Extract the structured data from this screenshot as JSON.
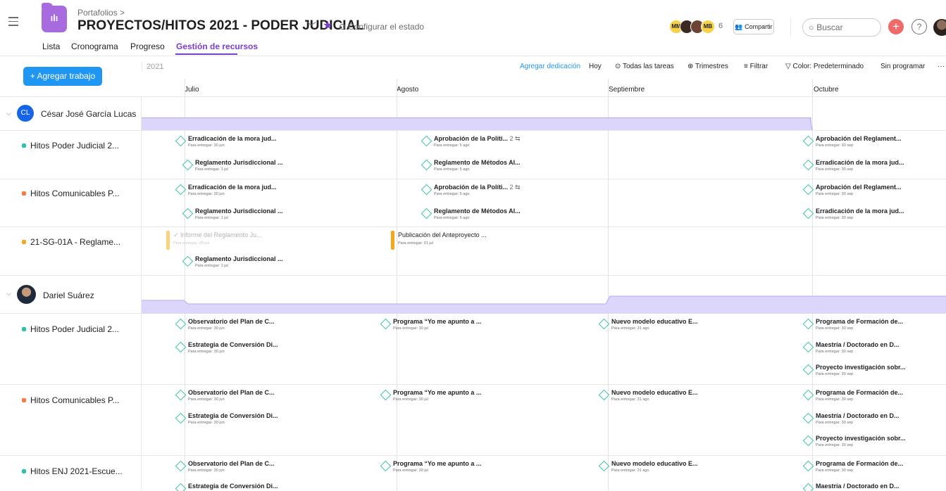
{
  "header": {
    "breadcrumb": "Portafolios >",
    "portfolio_icon": "chart-icon",
    "title": "PROYECTOS/HITOS 2021 - PODER JUDICIAL",
    "status": "Configurar el estado",
    "avatars": [
      "MM",
      "",
      "",
      "MB"
    ],
    "avatar_count": "6",
    "share": "Compartir",
    "search_placeholder": "Buscar",
    "help": "?"
  },
  "tabs": [
    "Lista",
    "Cronograma",
    "Progreso",
    "Gestión de recursos"
  ],
  "active_tab": "Gestión de recursos",
  "toolbar": {
    "add_work": "+ Agregar trabajo",
    "year": "2021",
    "add_dedication": "Agregar dedicación",
    "today": "Hoy",
    "all_tasks": "Todas las tareas",
    "quarters": "Trimestres",
    "filter": "Filtrar",
    "color": "Color: Predeterminado",
    "unscheduled": "Sin programar",
    "more": "···"
  },
  "months": [
    "Julio",
    "Agosto",
    "Septiembre",
    "Octubre"
  ],
  "people": [
    {
      "name": "César José García Lucas",
      "initials": "CL",
      "avatar_color": "#1565e6",
      "projects": [
        {
          "name": "Hitos Poder Judicial 2...",
          "color": "#27c6a8",
          "items": [
            {
              "type": "milestone",
              "title": "Erradicación de la mora jud...",
              "due": "Para entregar: 30 jun"
            },
            {
              "type": "milestone",
              "title": "Reglamento Jurisdiccional ...",
              "due": "Para entregar: 1 jul"
            },
            {
              "type": "milestone",
              "title": "Aprobación de la Políti...",
              "extra": "2",
              "due": "Para entregar: 5 ago"
            },
            {
              "type": "milestone",
              "title": "Reglamento de Métodos Al...",
              "due": "Para entregar: 5 ago"
            },
            {
              "type": "milestone",
              "title": "Aprobación del Reglament...",
              "due": "Para entregar: 30 sep"
            },
            {
              "type": "milestone",
              "title": "Erradicación de la mora jud...",
              "due": "Para entregar: 30 sep"
            }
          ]
        },
        {
          "name": "Hitos Comunicables P...",
          "color": "#fd7a3c",
          "items": [
            {
              "type": "milestone",
              "title": "Erradicación de la mora jud...",
              "due": "Para entregar: 30 jun"
            },
            {
              "type": "milestone",
              "title": "Reglamento Jurisdiccional ...",
              "due": "Para entregar: 1 jul"
            },
            {
              "type": "milestone",
              "title": "Aprobación de la Políti...",
              "extra": "2",
              "due": "Para entregar: 5 ago"
            },
            {
              "type": "milestone",
              "title": "Reglamento de Métodos Al...",
              "due": "Para entregar: 5 ago"
            },
            {
              "type": "milestone",
              "title": "Aprobación del Reglament...",
              "due": "Para entregar: 30 sep"
            },
            {
              "type": "milestone",
              "title": "Erradicación de la mora jud...",
              "due": "Para entregar: 30 sep"
            }
          ]
        },
        {
          "name": "21-SG-01A - Reglame...",
          "color": "#f8a519",
          "items": [
            {
              "type": "task",
              "title": "Informe del Reglamento Ju...",
              "due": "Para entregar: 28 jun",
              "done": true
            },
            {
              "type": "task",
              "title": "Publicación del Anteproyecto ...",
              "due": "Para entregar: 31 jul",
              "done": false
            },
            {
              "type": "milestone",
              "title": "Reglamento Jurisdiccional ...",
              "due": "Para entregar: 1 jul"
            }
          ]
        }
      ]
    },
    {
      "name": "Dariel Suárez",
      "initials": "",
      "avatar_color": "#3b2a22",
      "projects": [
        {
          "name": "Hitos Poder Judicial 2...",
          "color": "#27c6a8",
          "items": [
            {
              "type": "milestone",
              "title": "Observatorio del Plan de C...",
              "due": "Para entregar: 30 jun"
            },
            {
              "type": "milestone",
              "title": "Estrategia de Conversión Di...",
              "due": "Para entregar: 30 jun"
            },
            {
              "type": "milestone",
              "title": "Programa “Yo me apunto a ...",
              "due": "Para entregar: 30 jul"
            },
            {
              "type": "milestone",
              "title": "Nuevo modelo educativo E...",
              "due": "Para entregar: 31 ago"
            },
            {
              "type": "milestone",
              "title": "Programa de Formación de...",
              "due": "Para entregar: 30 sep"
            },
            {
              "type": "milestone",
              "title": "Maestría / Doctorado en D...",
              "due": "Para entregar: 30 sep"
            },
            {
              "type": "milestone",
              "title": "Proyecto investigación sobr...",
              "due": "Para entregar: 30 sep"
            }
          ]
        },
        {
          "name": "Hitos Comunicables P...",
          "color": "#fd7a3c",
          "items": [
            {
              "type": "milestone",
              "title": "Observatorio del Plan de C...",
              "due": "Para entregar: 30 jun"
            },
            {
              "type": "milestone",
              "title": "Estrategia de Conversión Di...",
              "due": "Para entregar: 30 jun"
            },
            {
              "type": "milestone",
              "title": "Programa “Yo me apunto a ...",
              "due": "Para entregar: 30 jul"
            },
            {
              "type": "milestone",
              "title": "Nuevo modelo educativo E...",
              "due": "Para entregar: 31 ago"
            },
            {
              "type": "milestone",
              "title": "Programa de Formación de...",
              "due": "Para entregar: 30 sep"
            },
            {
              "type": "milestone",
              "title": "Maestría / Doctorado en D...",
              "due": "Para entregar: 30 sep"
            },
            {
              "type": "milestone",
              "title": "Proyecto investigación sobr...",
              "due": "Para entregar: 30 sep"
            }
          ]
        },
        {
          "name": "Hitos ENJ 2021-Escue...",
          "color": "#27c6a8",
          "items": [
            {
              "type": "milestone",
              "title": "Observatorio del Plan de C...",
              "due": "Para entregar: 30 jun"
            },
            {
              "type": "milestone",
              "title": "Estrategia de Conversión Di...",
              "due": ""
            },
            {
              "type": "milestone",
              "title": "Programa “Yo me apunto a ...",
              "due": "Para entregar: 30 jul"
            },
            {
              "type": "milestone",
              "title": "Nuevo modelo educativo E...",
              "due": "Para entregar: 31 ago"
            },
            {
              "type": "milestone",
              "title": "Programa de Formación de...",
              "due": "Para entregar: 30 sep"
            },
            {
              "type": "milestone",
              "title": "Maestría / Doctorado en D...",
              "due": ""
            }
          ]
        }
      ]
    }
  ]
}
